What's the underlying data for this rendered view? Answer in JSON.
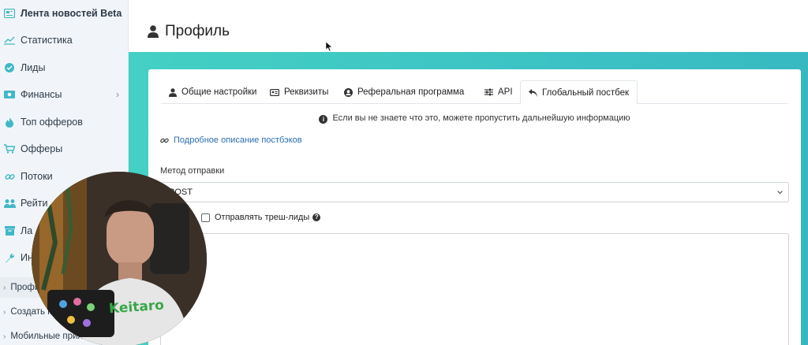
{
  "sidebar": {
    "items": [
      {
        "label": "Лента новостей Beta",
        "icon": "newspaper-icon"
      },
      {
        "label": "Статистика",
        "icon": "chart-line-icon"
      },
      {
        "label": "Лиды",
        "icon": "check-circle-icon"
      },
      {
        "label": "Финансы",
        "icon": "money-icon",
        "chevron": "›"
      },
      {
        "label": "Топ офферов",
        "icon": "fire-icon"
      },
      {
        "label": "Офферы",
        "icon": "cart-icon"
      },
      {
        "label": "Потоки",
        "icon": "link-icon"
      },
      {
        "label": "Рейти",
        "icon": "users-icon"
      },
      {
        "label": "Ла",
        "icon": "archive-icon"
      },
      {
        "label": "Ин",
        "icon": "wrench-icon"
      }
    ],
    "sub_items": [
      {
        "label": "Профи"
      },
      {
        "label": "Создать к"
      },
      {
        "label": "Мобильные прилож"
      }
    ]
  },
  "header": {
    "title": "Профиль",
    "icon": "user-icon"
  },
  "tabs": [
    {
      "label": "Общие настройки",
      "icon": "user-icon"
    },
    {
      "label": "Реквизиты",
      "icon": "id-card-icon"
    },
    {
      "label": "Реферальная программа",
      "icon": "user-circle-icon"
    },
    {
      "label": "API",
      "icon": "sliders-icon"
    },
    {
      "label": "Глобальный постбек",
      "icon": "reply-icon",
      "active": true
    }
  ],
  "notice": {
    "text": "Если вы не знаете что это, можете пропустить дальнейшую информацию",
    "icon": "info-circle-icon"
  },
  "doc_link": {
    "text": "Подробное описание постбэков",
    "icon": "link-icon"
  },
  "method": {
    "label": "Метод отправки",
    "value": "POST"
  },
  "trash_leads": {
    "label": "Отправлять треш-лиды",
    "checked": false,
    "help": "?"
  },
  "webcam": {
    "shirt_text": "Keitaro"
  },
  "colors": {
    "accent_teal": "#3cc3c4",
    "sidebar_bg": "#f1f5f9",
    "link": "#2a6fb0"
  }
}
